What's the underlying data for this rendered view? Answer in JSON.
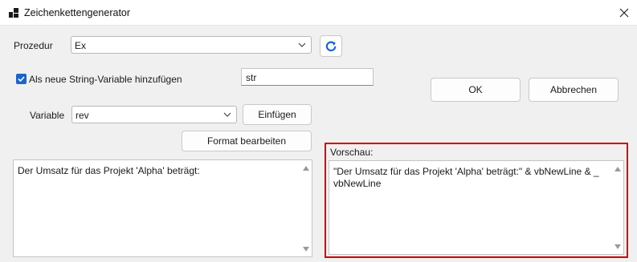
{
  "window": {
    "title": "Zeichenkettengenerator",
    "icon": "app-window-icon",
    "close_icon": "close-icon"
  },
  "procedure": {
    "label": "Prozedur",
    "value": "Ex",
    "refresh_icon": "refresh-icon"
  },
  "string_variable": {
    "checkbox_label": "Als neue String-Variable hinzufügen",
    "checked": true,
    "name_value": "str"
  },
  "variable": {
    "label": "Variable",
    "value": "rev",
    "insert_label": "Einfügen"
  },
  "format_button_label": "Format bearbeiten",
  "dialog_buttons": {
    "ok": "OK",
    "cancel": "Abbrechen"
  },
  "input_text": "Der Umsatz für das Projekt 'Alpha' beträgt:",
  "preview": {
    "label": "Vorschau:",
    "text": "\"Der Umsatz für das Projekt 'Alpha' beträgt:\" & vbNewLine & _\nvbNewLine"
  },
  "colors": {
    "accent": "#1e63c6",
    "highlight_border": "#d00000"
  }
}
